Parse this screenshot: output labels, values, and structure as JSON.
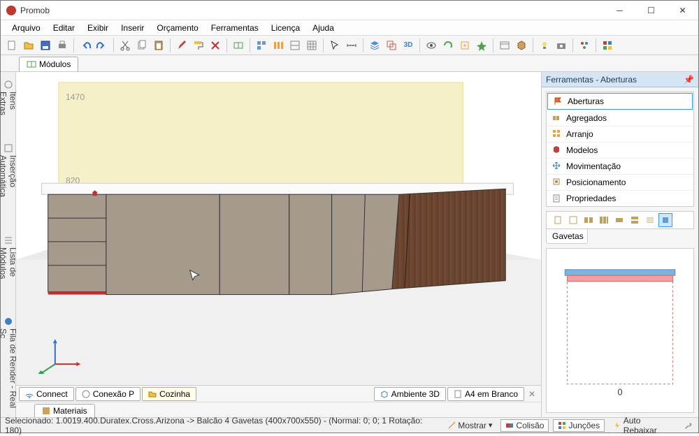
{
  "app": {
    "title": "Promob"
  },
  "menu": [
    "Arquivo",
    "Editar",
    "Exibir",
    "Inserir",
    "Orçamento",
    "Ferramentas",
    "Licença",
    "Ajuda"
  ],
  "topTab": {
    "label": "Módulos"
  },
  "leftTabs": [
    "Itens Extras",
    "Inserção Automática",
    "Lista de Módulos",
    "Fila de Render - Real Sc"
  ],
  "viewport": {
    "dim1": "1470",
    "dim2": "820"
  },
  "vpBottom": {
    "connect": "Connect",
    "conexao": "Conexão P",
    "cozinha": "Cozinha",
    "ambiente": "Ambiente 3D",
    "a4": "A4 em Branco"
  },
  "materiaisTab": "Materiais",
  "rightPanel": {
    "header": "Ferramentas - Aberturas",
    "items": [
      "Aberturas",
      "Agregados",
      "Arranjo",
      "Modelos",
      "Movimentação",
      "Posicionamento",
      "Propriedades"
    ],
    "gavetas": "Gavetas",
    "previewLabel": "0"
  },
  "status": {
    "text": "Selecionado: 1.0019.400.Duratex.Cross.Arizona -> Balcão 4 Gavetas (400x700x550) - (Normal: 0; 0; 1 Rotação: 180)",
    "mostrar": "Mostrar",
    "colisao": "Colisão",
    "juncoes": "Junções",
    "auto": "Auto Rebaixar"
  }
}
